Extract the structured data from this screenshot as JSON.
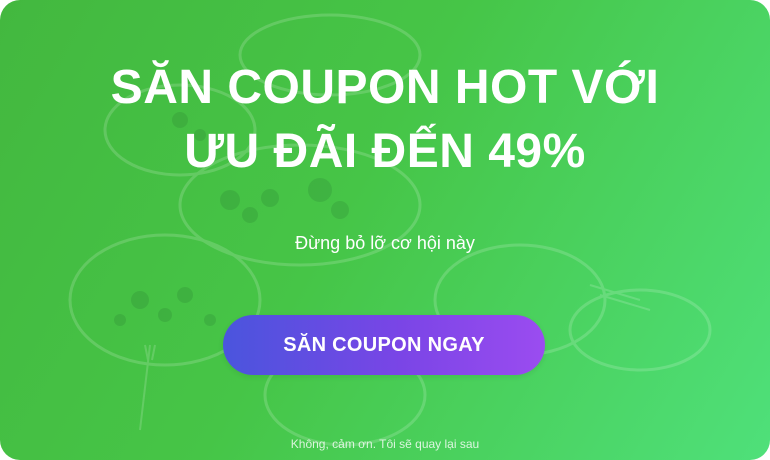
{
  "popup": {
    "headline_line1": "SĂN COUPON HOT VỚI",
    "headline_line2": "ƯU ĐÃI ĐẾN 49%",
    "subtext": "Đừng bỏ lỡ cơ hội này",
    "cta_label": "SĂN COUPON NGAY",
    "dismiss_label": "Không, cảm ơn. Tôi sẽ quay lại sau"
  },
  "colors": {
    "background_start": "#43b83f",
    "background_end": "#4fe07a",
    "cta_start": "#4a55dd",
    "cta_end": "#9b4cf0",
    "text": "#ffffff"
  },
  "icons": {
    "background": "food-table-illustration"
  }
}
